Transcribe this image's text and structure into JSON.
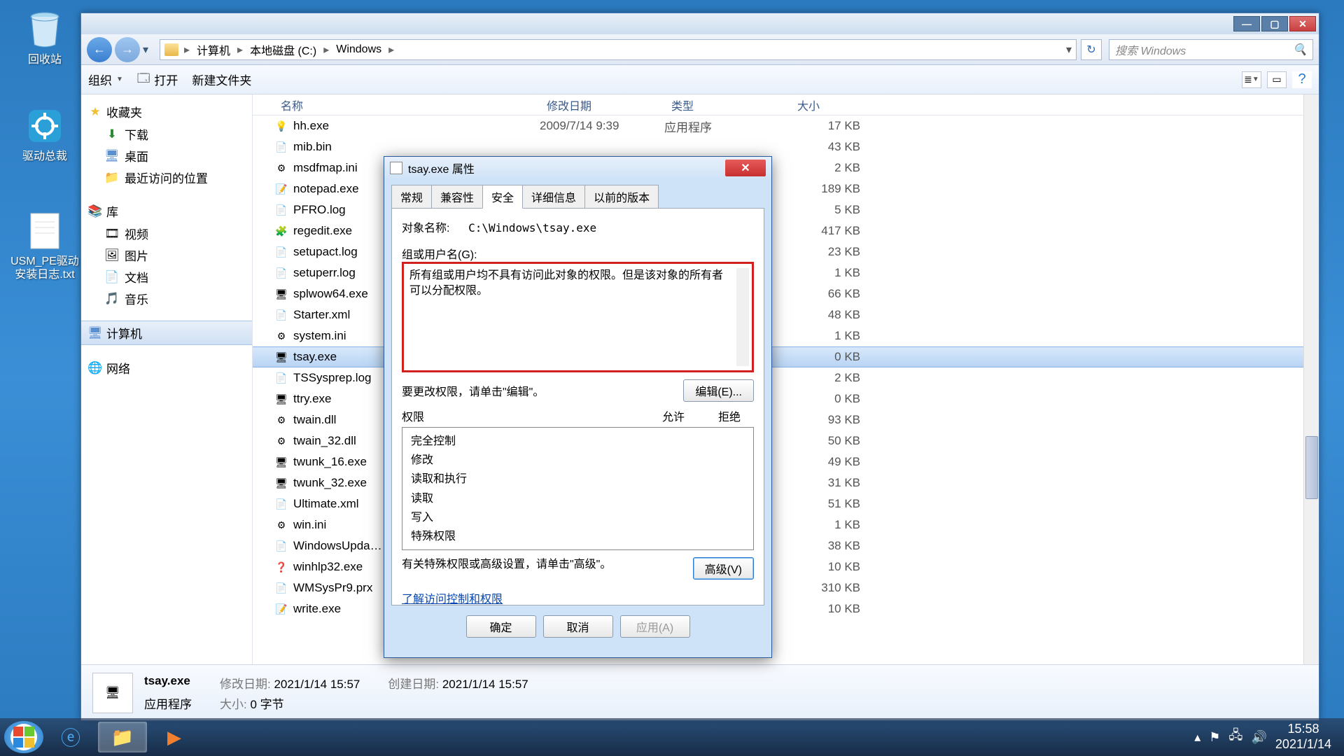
{
  "desktop": {
    "icons": [
      {
        "name": "recycle-bin",
        "label": "回收站"
      },
      {
        "name": "driver-app",
        "label": "驱动总裁"
      },
      {
        "name": "txt-file",
        "label": "USM_PE驱动\n安装日志.txt"
      }
    ]
  },
  "explorer": {
    "titlebuttons": {
      "min": "—",
      "max": "▢",
      "close": "✕"
    },
    "breadcrumb": {
      "segs": [
        "计算机",
        "本地磁盘 (C:)",
        "Windows"
      ]
    },
    "search_placeholder": "搜索 Windows",
    "toolbar": {
      "organize": "组织",
      "open": "打开",
      "newfolder": "新建文件夹"
    },
    "sidebar": {
      "favorites": {
        "hdr": "收藏夹",
        "items": [
          "下载",
          "桌面",
          "最近访问的位置"
        ]
      },
      "libraries": {
        "hdr": "库",
        "items": [
          "视频",
          "图片",
          "文档",
          "音乐"
        ]
      },
      "computer": "计算机",
      "network": "网络"
    },
    "columns": {
      "name": "名称",
      "date": "修改日期",
      "type": "类型",
      "size": "大小"
    },
    "files": [
      {
        "name": "hh.exe",
        "date": "2009/7/14 9:39",
        "type": "应用程序",
        "size": "17 KB",
        "ic": "💡"
      },
      {
        "name": "mib.bin",
        "date": "",
        "type": "",
        "size": "43 KB",
        "ic": "📄"
      },
      {
        "name": "msdfmap.ini",
        "date": "",
        "type": "",
        "size": "2 KB",
        "ic": "⚙"
      },
      {
        "name": "notepad.exe",
        "date": "",
        "type": "",
        "size": "189 KB",
        "ic": "📝"
      },
      {
        "name": "PFRO.log",
        "date": "",
        "type": "",
        "size": "5 KB",
        "ic": "📄"
      },
      {
        "name": "regedit.exe",
        "date": "",
        "type": "",
        "size": "417 KB",
        "ic": "🧩"
      },
      {
        "name": "setupact.log",
        "date": "",
        "type": "",
        "size": "23 KB",
        "ic": "📄"
      },
      {
        "name": "setuperr.log",
        "date": "",
        "type": "",
        "size": "1 KB",
        "ic": "📄"
      },
      {
        "name": "splwow64.exe",
        "date": "",
        "type": "",
        "size": "66 KB",
        "ic": "🖥"
      },
      {
        "name": "Starter.xml",
        "date": "",
        "type": "",
        "size": "48 KB",
        "ic": "📄"
      },
      {
        "name": "system.ini",
        "date": "",
        "type": "",
        "size": "1 KB",
        "ic": "⚙"
      },
      {
        "name": "tsay.exe",
        "date": "",
        "type": "",
        "size": "0 KB",
        "ic": "🖥",
        "sel": true
      },
      {
        "name": "TSSysprep.log",
        "date": "",
        "type": "",
        "size": "2 KB",
        "ic": "📄"
      },
      {
        "name": "ttry.exe",
        "date": "",
        "type": "",
        "size": "0 KB",
        "ic": "🖥"
      },
      {
        "name": "twain.dll",
        "date": "",
        "type": "",
        "size": "93 KB",
        "ic": "⚙"
      },
      {
        "name": "twain_32.dll",
        "date": "",
        "type": "",
        "size": "50 KB",
        "ic": "⚙"
      },
      {
        "name": "twunk_16.exe",
        "date": "",
        "type": "",
        "size": "49 KB",
        "ic": "🖥"
      },
      {
        "name": "twunk_32.exe",
        "date": "",
        "type": "",
        "size": "31 KB",
        "ic": "🖥"
      },
      {
        "name": "Ultimate.xml",
        "date": "",
        "type": "",
        "size": "51 KB",
        "ic": "📄"
      },
      {
        "name": "win.ini",
        "date": "",
        "type": "",
        "size": "1 KB",
        "ic": "⚙"
      },
      {
        "name": "WindowsUpda…",
        "date": "",
        "type": "",
        "size": "38 KB",
        "ic": "📄"
      },
      {
        "name": "winhlp32.exe",
        "date": "",
        "type": "",
        "size": "10 KB",
        "ic": "❓"
      },
      {
        "name": "WMSysPr9.prx",
        "date": "",
        "type": "",
        "size": "310 KB",
        "ic": "📄"
      },
      {
        "name": "write.exe",
        "date": "",
        "type": "",
        "size": "10 KB",
        "ic": "📝"
      }
    ],
    "details": {
      "name": "tsay.exe",
      "type": "应用程序",
      "modlabel": "修改日期:",
      "moddate": "2021/1/14 15:57",
      "createlabel": "创建日期:",
      "createdate": "2021/1/14 15:57",
      "sizelabel": "大小:",
      "size": "0 字节"
    }
  },
  "properties": {
    "title": "tsay.exe 属性",
    "tabs": [
      "常规",
      "兼容性",
      "安全",
      "详细信息",
      "以前的版本"
    ],
    "active_tab": 2,
    "object_label": "对象名称:",
    "object_path": "C:\\Windows\\tsay.exe",
    "group_label": "组或用户名(G):",
    "group_msg": "所有组或用户均不具有访问此对象的权限。但是该对象的所有者可以分配权限。",
    "edit_hint": "要更改权限，请单击\"编辑\"。",
    "edit_btn": "编辑(E)...",
    "perm_label": "权限",
    "allow": "允许",
    "deny": "拒绝",
    "perms": [
      "完全控制",
      "修改",
      "读取和执行",
      "读取",
      "写入",
      "特殊权限"
    ],
    "adv_hint": "有关特殊权限或高级设置，请单击\"高级\"。",
    "adv_btn": "高级(V)",
    "learn_link": "了解访问控制和权限",
    "ok": "确定",
    "cancel": "取消",
    "apply": "应用(A)"
  },
  "taskbar": {
    "time": "15:58",
    "date": "2021/1/14"
  }
}
